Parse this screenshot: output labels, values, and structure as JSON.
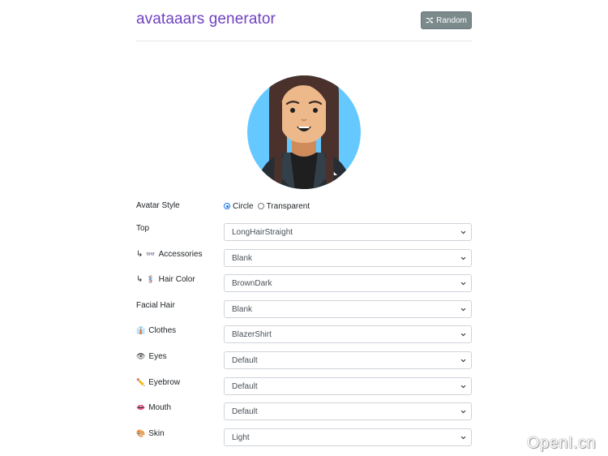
{
  "header": {
    "title": "avataaars generator",
    "random_label": "Random"
  },
  "avatar_style": {
    "label": "Avatar Style",
    "options": [
      "Circle",
      "Transparent"
    ],
    "selected": "Circle"
  },
  "fields": [
    {
      "label": "Top",
      "emoji": "",
      "prefix": "",
      "value": "LongHairStraight"
    },
    {
      "label": "Accessories",
      "emoji": "👓",
      "prefix": "↳",
      "value": "Blank"
    },
    {
      "label": "Hair Color",
      "emoji": "💈",
      "prefix": "↳",
      "value": "BrownDark"
    },
    {
      "label": "Facial Hair",
      "emoji": "",
      "prefix": "",
      "value": "Blank"
    },
    {
      "label": "Clothes",
      "emoji": "👔",
      "prefix": "",
      "value": "BlazerShirt"
    },
    {
      "label": "Eyes",
      "emoji": "👁",
      "prefix": "",
      "value": "Default"
    },
    {
      "label": "Eyebrow",
      "emoji": "✏️",
      "prefix": "",
      "value": "Default"
    },
    {
      "label": "Mouth",
      "emoji": "👄",
      "prefix": "",
      "value": "Default"
    },
    {
      "label": "Skin",
      "emoji": "🎨",
      "prefix": "",
      "value": "Light"
    }
  ],
  "watermark": "OpenI.cn",
  "colors": {
    "title": "#6f42c1",
    "button_bg": "#7b8a8b",
    "avatar_bg": "#65c9ff",
    "hair": "#4a312c",
    "skin": "#edb98a",
    "blazer": "#262e33"
  }
}
